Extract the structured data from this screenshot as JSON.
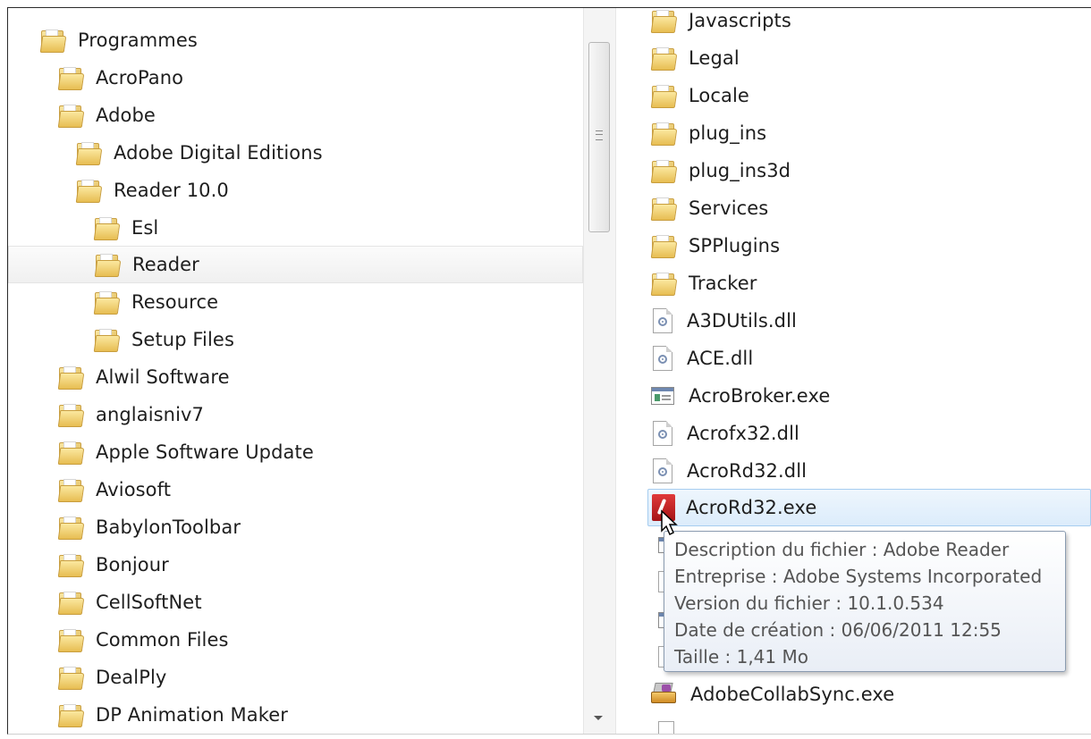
{
  "nav_tree": [
    {
      "label": "Programmes",
      "level": 0
    },
    {
      "label": "AcroPano",
      "level": 1
    },
    {
      "label": "Adobe",
      "level": 1
    },
    {
      "label": "Adobe Digital Editions",
      "level": 2
    },
    {
      "label": "Reader 10.0",
      "level": 2
    },
    {
      "label": "Esl",
      "level": 3
    },
    {
      "label": "Reader",
      "level": 3,
      "selected": true
    },
    {
      "label": "Resource",
      "level": 3
    },
    {
      "label": "Setup Files",
      "level": 3
    },
    {
      "label": "Alwil Software",
      "level": 1
    },
    {
      "label": "anglaisniv7",
      "level": 1
    },
    {
      "label": "Apple Software Update",
      "level": 1
    },
    {
      "label": "Aviosoft",
      "level": 1
    },
    {
      "label": "BabylonToolbar",
      "level": 1
    },
    {
      "label": "Bonjour",
      "level": 1
    },
    {
      "label": "CellSoftNet",
      "level": 1
    },
    {
      "label": "Common Files",
      "level": 1
    },
    {
      "label": "DealPly",
      "level": 1
    },
    {
      "label": "DP Animation Maker",
      "level": 1
    }
  ],
  "files": [
    {
      "name": "Javascripts",
      "icon": "folder-icon"
    },
    {
      "name": "Legal",
      "icon": "folder-icon"
    },
    {
      "name": "Locale",
      "icon": "folder-icon"
    },
    {
      "name": "plug_ins",
      "icon": "folder-icon"
    },
    {
      "name": "plug_ins3d",
      "icon": "folder-icon"
    },
    {
      "name": "Services",
      "icon": "folder-icon"
    },
    {
      "name": "SPPlugins",
      "icon": "folder-icon"
    },
    {
      "name": "Tracker",
      "icon": "folder-icon"
    },
    {
      "name": "A3DUtils.dll",
      "icon": "dll-icon"
    },
    {
      "name": "ACE.dll",
      "icon": "dll-icon"
    },
    {
      "name": "AcroBroker.exe",
      "icon": "exe-icon"
    },
    {
      "name": "Acrofx32.dll",
      "icon": "dll-icon"
    },
    {
      "name": "AcroRd32.dll",
      "icon": "dll-icon"
    },
    {
      "name": "AcroRd32.exe",
      "icon": "adobe-reader-icon",
      "hovered": true
    },
    {
      "name": "AdobeCollabSync.exe",
      "icon": "collab-sync-icon"
    }
  ],
  "tooltip": {
    "description": "Description du fichier : Adobe Reader",
    "company": "Entreprise : Adobe Systems Incorporated",
    "version": "Version du fichier : 10.1.0.534",
    "created": "Date de création : 06/06/2011 12:55",
    "size": "Taille : 1,41 Mo"
  },
  "colors": {
    "hover_bg": "#dcecfb",
    "hover_border": "#a6cdf0",
    "tooltip_text": "#555555"
  }
}
